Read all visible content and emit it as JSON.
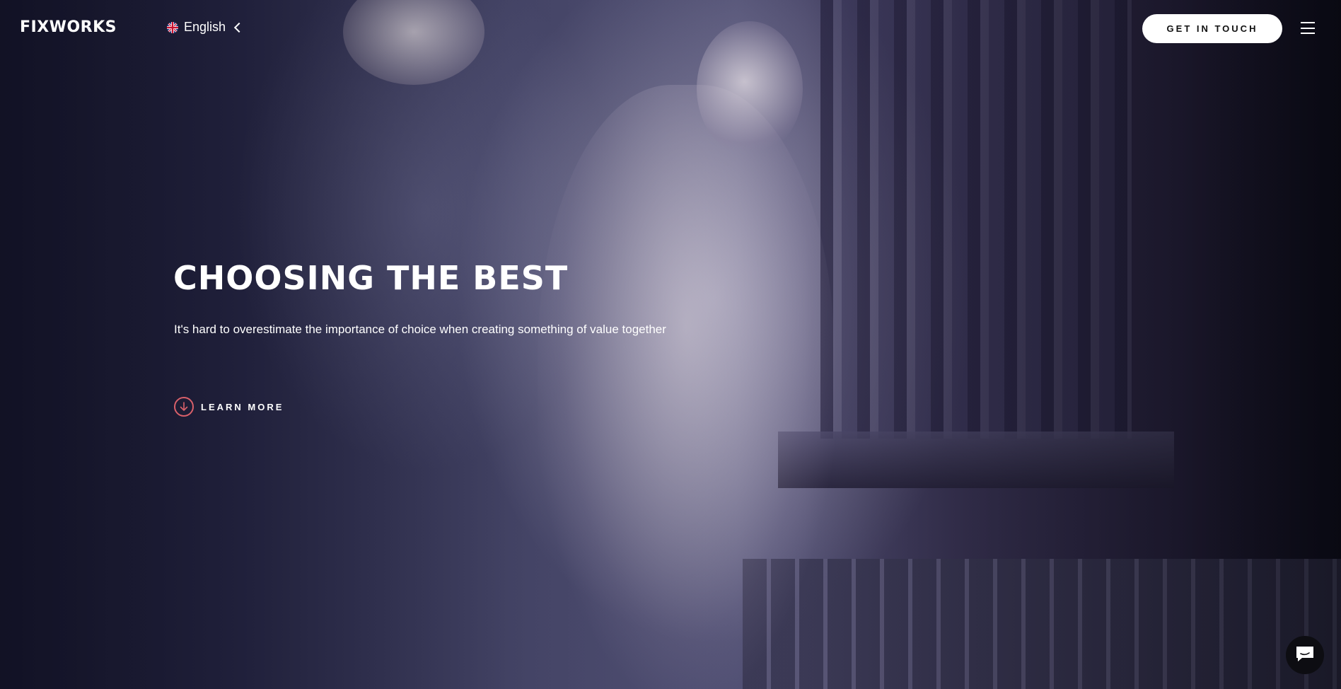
{
  "header": {
    "logo": "FIXWORKS",
    "language": {
      "label": "English",
      "flag_icon": "uk-flag-icon",
      "chevron_icon": "chevron-left-icon"
    },
    "cta_label": "GET IN TOUCH",
    "menu_icon": "hamburger-menu-icon"
  },
  "hero": {
    "title": "CHOOSING THE BEST",
    "subtitle": "It's hard to overestimate the importance of choice when creating something of value together",
    "learn_more": {
      "label": "LEARN MORE",
      "icon": "arrow-down-circle-icon"
    },
    "background": "marble-statue-photo"
  },
  "chat_widget": {
    "icon": "chat-icon"
  },
  "colors": {
    "accent": "#d9606a",
    "text": "#ffffff",
    "cta_bg": "#ffffff",
    "chat_bg": "#0d0d12"
  }
}
